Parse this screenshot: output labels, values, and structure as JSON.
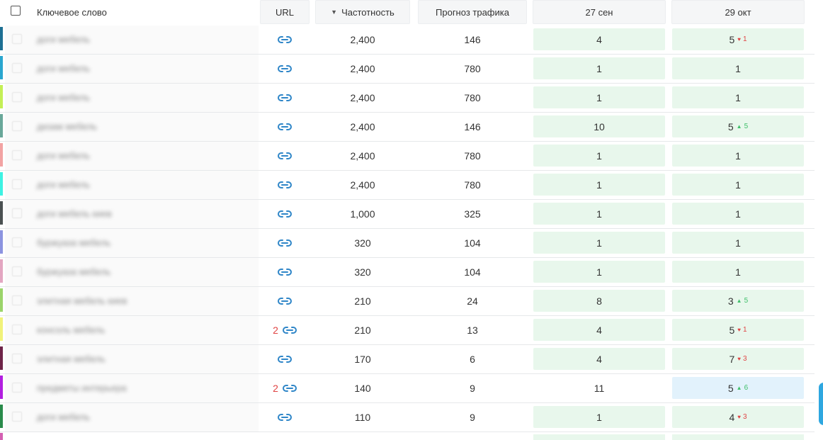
{
  "header": {
    "keyword": "Ключевое слово",
    "url": "URL",
    "frequency": "Частотность",
    "sort_arrow": "▼",
    "traffic": "Прогноз трафика",
    "date1": "27 сен",
    "date2": "29 окт"
  },
  "colors": {
    "accent_link": "#2f86c8",
    "green_cell": "#e8f7ec",
    "blue_cell": "#e2f2fc",
    "up": "#3fbf6a",
    "down": "#e04444"
  },
  "rows": [
    {
      "color": "#1d6f93",
      "keyword": "доги мебель",
      "url_count": "",
      "freq": "2,400",
      "traffic": "146",
      "d1": "4",
      "d1_bg": "green",
      "d2": "5",
      "d2_bg": "green",
      "chg": "1",
      "dir": "down"
    },
    {
      "color": "#2aa6cf",
      "keyword": "доги мебель",
      "url_count": "",
      "freq": "2,400",
      "traffic": "780",
      "d1": "1",
      "d1_bg": "green",
      "d2": "1",
      "d2_bg": "green",
      "chg": "",
      "dir": ""
    },
    {
      "color": "#c4ef56",
      "keyword": "доги мебель",
      "url_count": "",
      "freq": "2,400",
      "traffic": "780",
      "d1": "1",
      "d1_bg": "green",
      "d2": "1",
      "d2_bg": "green",
      "chg": "",
      "dir": ""
    },
    {
      "color": "#6aa89a",
      "keyword": "дизам мебель",
      "url_count": "",
      "freq": "2,400",
      "traffic": "146",
      "d1": "10",
      "d1_bg": "green",
      "d2": "5",
      "d2_bg": "green",
      "chg": "5",
      "dir": "up"
    },
    {
      "color": "#f2a3a3",
      "keyword": "доги мебель",
      "url_count": "",
      "freq": "2,400",
      "traffic": "780",
      "d1": "1",
      "d1_bg": "green",
      "d2": "1",
      "d2_bg": "green",
      "chg": "",
      "dir": ""
    },
    {
      "color": "#3ef2e3",
      "keyword": "доги мебель",
      "url_count": "",
      "freq": "2,400",
      "traffic": "780",
      "d1": "1",
      "d1_bg": "green",
      "d2": "1",
      "d2_bg": "green",
      "chg": "",
      "dir": ""
    },
    {
      "color": "#4b5152",
      "keyword": "доги мебель киев",
      "url_count": "",
      "freq": "1,000",
      "traffic": "325",
      "d1": "1",
      "d1_bg": "green",
      "d2": "1",
      "d2_bg": "green",
      "chg": "",
      "dir": ""
    },
    {
      "color": "#8c94e0",
      "keyword": "буржуаза мебель",
      "url_count": "",
      "freq": "320",
      "traffic": "104",
      "d1": "1",
      "d1_bg": "green",
      "d2": "1",
      "d2_bg": "green",
      "chg": "",
      "dir": ""
    },
    {
      "color": "#e3a6c1",
      "keyword": "буржуаза мебель",
      "url_count": "",
      "freq": "320",
      "traffic": "104",
      "d1": "1",
      "d1_bg": "green",
      "d2": "1",
      "d2_bg": "green",
      "chg": "",
      "dir": ""
    },
    {
      "color": "#9bd46b",
      "keyword": "элитная мебель киев",
      "url_count": "",
      "freq": "210",
      "traffic": "24",
      "d1": "8",
      "d1_bg": "green",
      "d2": "3",
      "d2_bg": "green",
      "chg": "5",
      "dir": "up"
    },
    {
      "color": "#f1f27a",
      "keyword": "консоль мебель",
      "url_count": "2",
      "freq": "210",
      "traffic": "13",
      "d1": "4",
      "d1_bg": "green",
      "d2": "5",
      "d2_bg": "green",
      "chg": "1",
      "dir": "down"
    },
    {
      "color": "#6e2448",
      "keyword": "элитная мебель",
      "url_count": "",
      "freq": "170",
      "traffic": "6",
      "d1": "4",
      "d1_bg": "green",
      "d2": "7",
      "d2_bg": "green",
      "chg": "3",
      "dir": "down"
    },
    {
      "color": "#b21ee0",
      "keyword": "предметы интерьера",
      "url_count": "2",
      "freq": "140",
      "traffic": "9",
      "d1": "11",
      "d1_bg": "none",
      "d2": "5",
      "d2_bg": "blue",
      "chg": "6",
      "dir": "up"
    },
    {
      "color": "#2a8b4b",
      "keyword": "доги мебель",
      "url_count": "",
      "freq": "110",
      "traffic": "9",
      "d1": "1",
      "d1_bg": "green",
      "d2": "4",
      "d2_bg": "green",
      "chg": "3",
      "dir": "down"
    }
  ]
}
